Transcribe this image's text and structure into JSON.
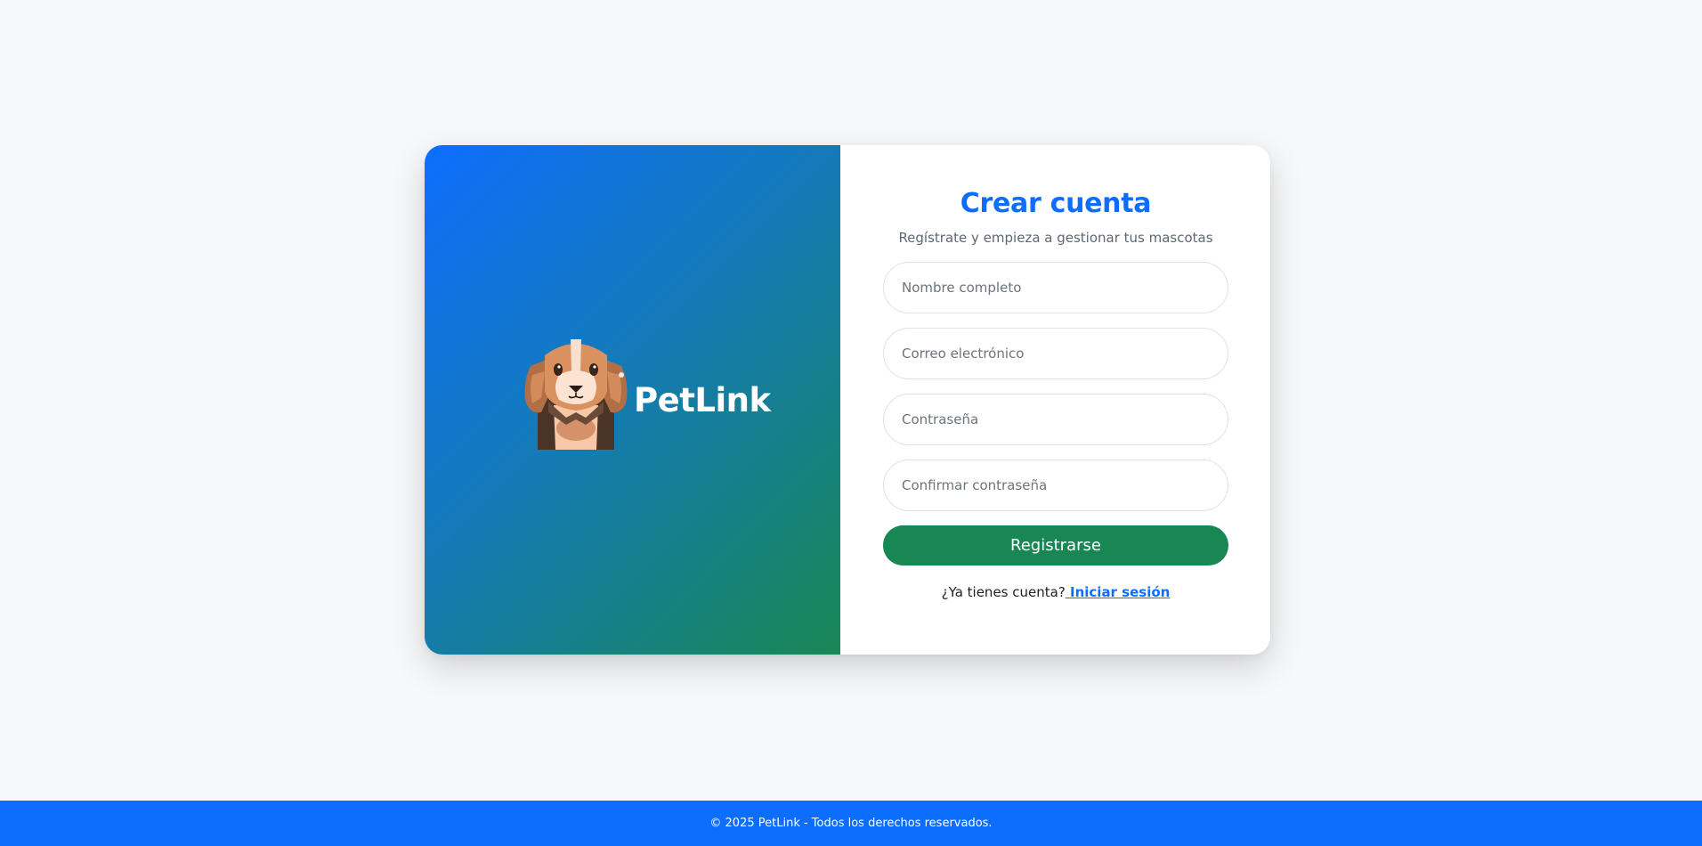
{
  "brand": {
    "name": "PetLink",
    "logo_icon": "dog-icon"
  },
  "form": {
    "title": "Crear cuenta",
    "subtitle": "Regístrate y empieza a gestionar tus mascotas",
    "fields": {
      "name_placeholder": "Nombre completo",
      "email_placeholder": "Correo electrónico",
      "password_placeholder": "Contraseña",
      "confirm_placeholder": "Confirmar contraseña"
    },
    "submit_label": "Registrarse",
    "login_prompt": "¿Ya tienes cuenta?",
    "login_link": " Iniciar sesión"
  },
  "footer": {
    "text": "© 2025 PetLink - Todos los derechos reservados."
  },
  "colors": {
    "primary": "#0d6efd",
    "success": "#198754",
    "background": "#f7f8fa"
  }
}
